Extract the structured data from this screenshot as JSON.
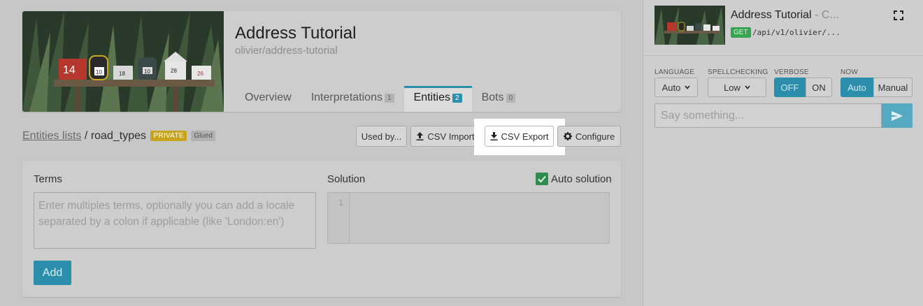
{
  "app": {
    "title": "Address Tutorial",
    "slug": "olivier/address-tutorial",
    "tabs": [
      {
        "label": "Overview",
        "count": null,
        "active": false
      },
      {
        "label": "Interpretations",
        "count": "1",
        "active": false
      },
      {
        "label": "Entities",
        "count": "2",
        "active": true
      },
      {
        "label": "Bots",
        "count": "0",
        "active": false
      }
    ]
  },
  "breadcrumb": {
    "link": "Entities lists",
    "separator": "/",
    "current": "road_types",
    "badge_private": "PRIVATE",
    "badge_glued": "Glued"
  },
  "toolbar": {
    "used_by": "Used by...",
    "csv_import": "CSV Import",
    "csv_export": "CSV Export",
    "configure": "Configure"
  },
  "editor": {
    "terms_label": "Terms",
    "terms_placeholder": "Enter multiples terms, optionally you can add a locale separated by a colon if applicable (like 'London:en')",
    "solution_label": "Solution",
    "auto_solution_label": "Auto solution",
    "auto_solution_checked": true,
    "line_number": "1",
    "add_button": "Add"
  },
  "console": {
    "title": "Address Tutorial",
    "title_suffix": "- C...",
    "method": "GET",
    "path": "/api/v1/olivier/...",
    "language_label": "LANGUAGE",
    "language_value": "Auto",
    "spellchecking_label": "SPELLCHECKING",
    "spellchecking_value": "Low",
    "verbose_label": "VERBOSE",
    "verbose_off": "OFF",
    "verbose_on": "ON",
    "now_label": "NOW",
    "now_auto": "Auto",
    "now_manual": "Manual",
    "input_placeholder": "Say something...",
    "input_value": ""
  },
  "colors": {
    "accent": "#2b8fab",
    "private_badge": "#c9a41f",
    "get_badge": "#35a64f",
    "checkbox": "#2d8c4e"
  },
  "mailboxes": [
    "14",
    "10",
    "18",
    "10",
    "28",
    "26"
  ]
}
